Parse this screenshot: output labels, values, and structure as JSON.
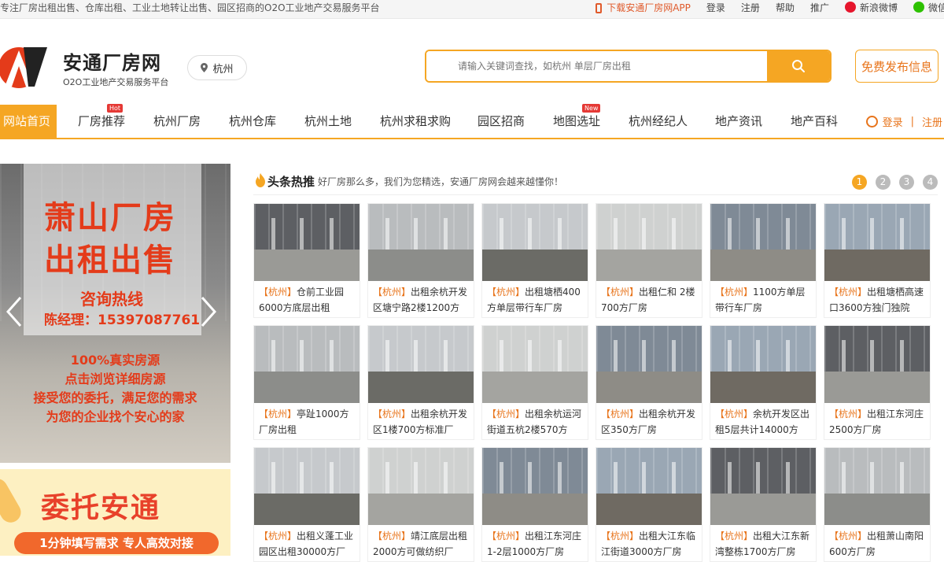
{
  "topbar": {
    "slogan": "专注厂房出租出售、仓库出租、工业土地转让出售、园区招商的O2O工业地产交易服务平台",
    "app_download": "下载安通厂房网APP",
    "login": "登录",
    "register": "注册",
    "help": "帮助",
    "promote": "推广",
    "weibo": "新浪微博",
    "wechat": "微信"
  },
  "header": {
    "brand": "安通厂房网",
    "brand_sub": "O2O工业地产交易服务平台",
    "city": "杭州",
    "search_placeholder": "请输入关键词查找，如杭州 单层厂房出租",
    "publish": "免费发布信息"
  },
  "nav": {
    "items": [
      {
        "label": "网站首页"
      },
      {
        "label": "厂房推荐",
        "badge": "Hot"
      },
      {
        "label": "杭州厂房"
      },
      {
        "label": "杭州仓库"
      },
      {
        "label": "杭州土地"
      },
      {
        "label": "杭州求租求购"
      },
      {
        "label": "园区招商"
      },
      {
        "label": "地图选址",
        "badge": "New"
      },
      {
        "label": "杭州经纪人"
      },
      {
        "label": "地产资讯"
      },
      {
        "label": "地产百科"
      }
    ],
    "login": "登录",
    "separator": "|",
    "register": "注册"
  },
  "banner": {
    "line1": "萧山厂房",
    "line2": "出租出售",
    "hotline": "咨询热线",
    "contact": "陈经理：15397087761",
    "lines": [
      "100%真实房源",
      "点击浏览详细房源",
      "接受您的委托，满足您的需求",
      "为您的企业找个安心的家"
    ]
  },
  "promo": {
    "title": "委托安通",
    "sub": "1分钟填写需求 专人高效对接"
  },
  "hot": {
    "title": "头条热推",
    "desc": "好厂房那么多，我们为您精选，安通厂房网会越来越懂你！",
    "pages": [
      "1",
      "2",
      "3",
      "4"
    ],
    "current_page": "1"
  },
  "listings": [
    {
      "city": "【杭州】",
      "text": "仓前工业园6000方底层出租"
    },
    {
      "city": "【杭州】",
      "text": "出租余杭开发区塘宁路2楼1200方"
    },
    {
      "city": "【杭州】",
      "text": "出租塘栖400方单层带行车厂房"
    },
    {
      "city": "【杭州】",
      "text": "出租仁和 2楼700方厂房"
    },
    {
      "city": "【杭州】",
      "text": "1100方单层带行车厂房"
    },
    {
      "city": "【杭州】",
      "text": "出租塘栖高速口3600方独门独院"
    },
    {
      "city": "【杭州】",
      "text": "亭趾1000方厂房出租"
    },
    {
      "city": "【杭州】",
      "text": "出租余杭开发区1楼700方标准厂"
    },
    {
      "city": "【杭州】",
      "text": "出租余杭运河街道五杭2楼570方"
    },
    {
      "city": "【杭州】",
      "text": "出租余杭开发区350方厂房"
    },
    {
      "city": "【杭州】",
      "text": "余杭开发区出租5层共计14000方"
    },
    {
      "city": "【杭州】",
      "text": "出租江东河庄2500方厂房"
    },
    {
      "city": "【杭州】",
      "text": "出租义蓬工业园区出租30000方厂"
    },
    {
      "city": "【杭州】",
      "text": "靖江底层出租2000方可做纺织厂"
    },
    {
      "city": "【杭州】",
      "text": "出租江东河庄1-2层1000方厂房"
    },
    {
      "city": "【杭州】",
      "text": "出租大江东临江街道3000方厂房"
    },
    {
      "city": "【杭州】",
      "text": "出租大江东新湾整栋1700方厂房"
    },
    {
      "city": "【杭州】",
      "text": "出租萧山南阳600方厂房"
    }
  ],
  "colors": {
    "accent": "#f5a623",
    "text_accent": "#e8741b",
    "banner_red": "#e43b1a"
  }
}
